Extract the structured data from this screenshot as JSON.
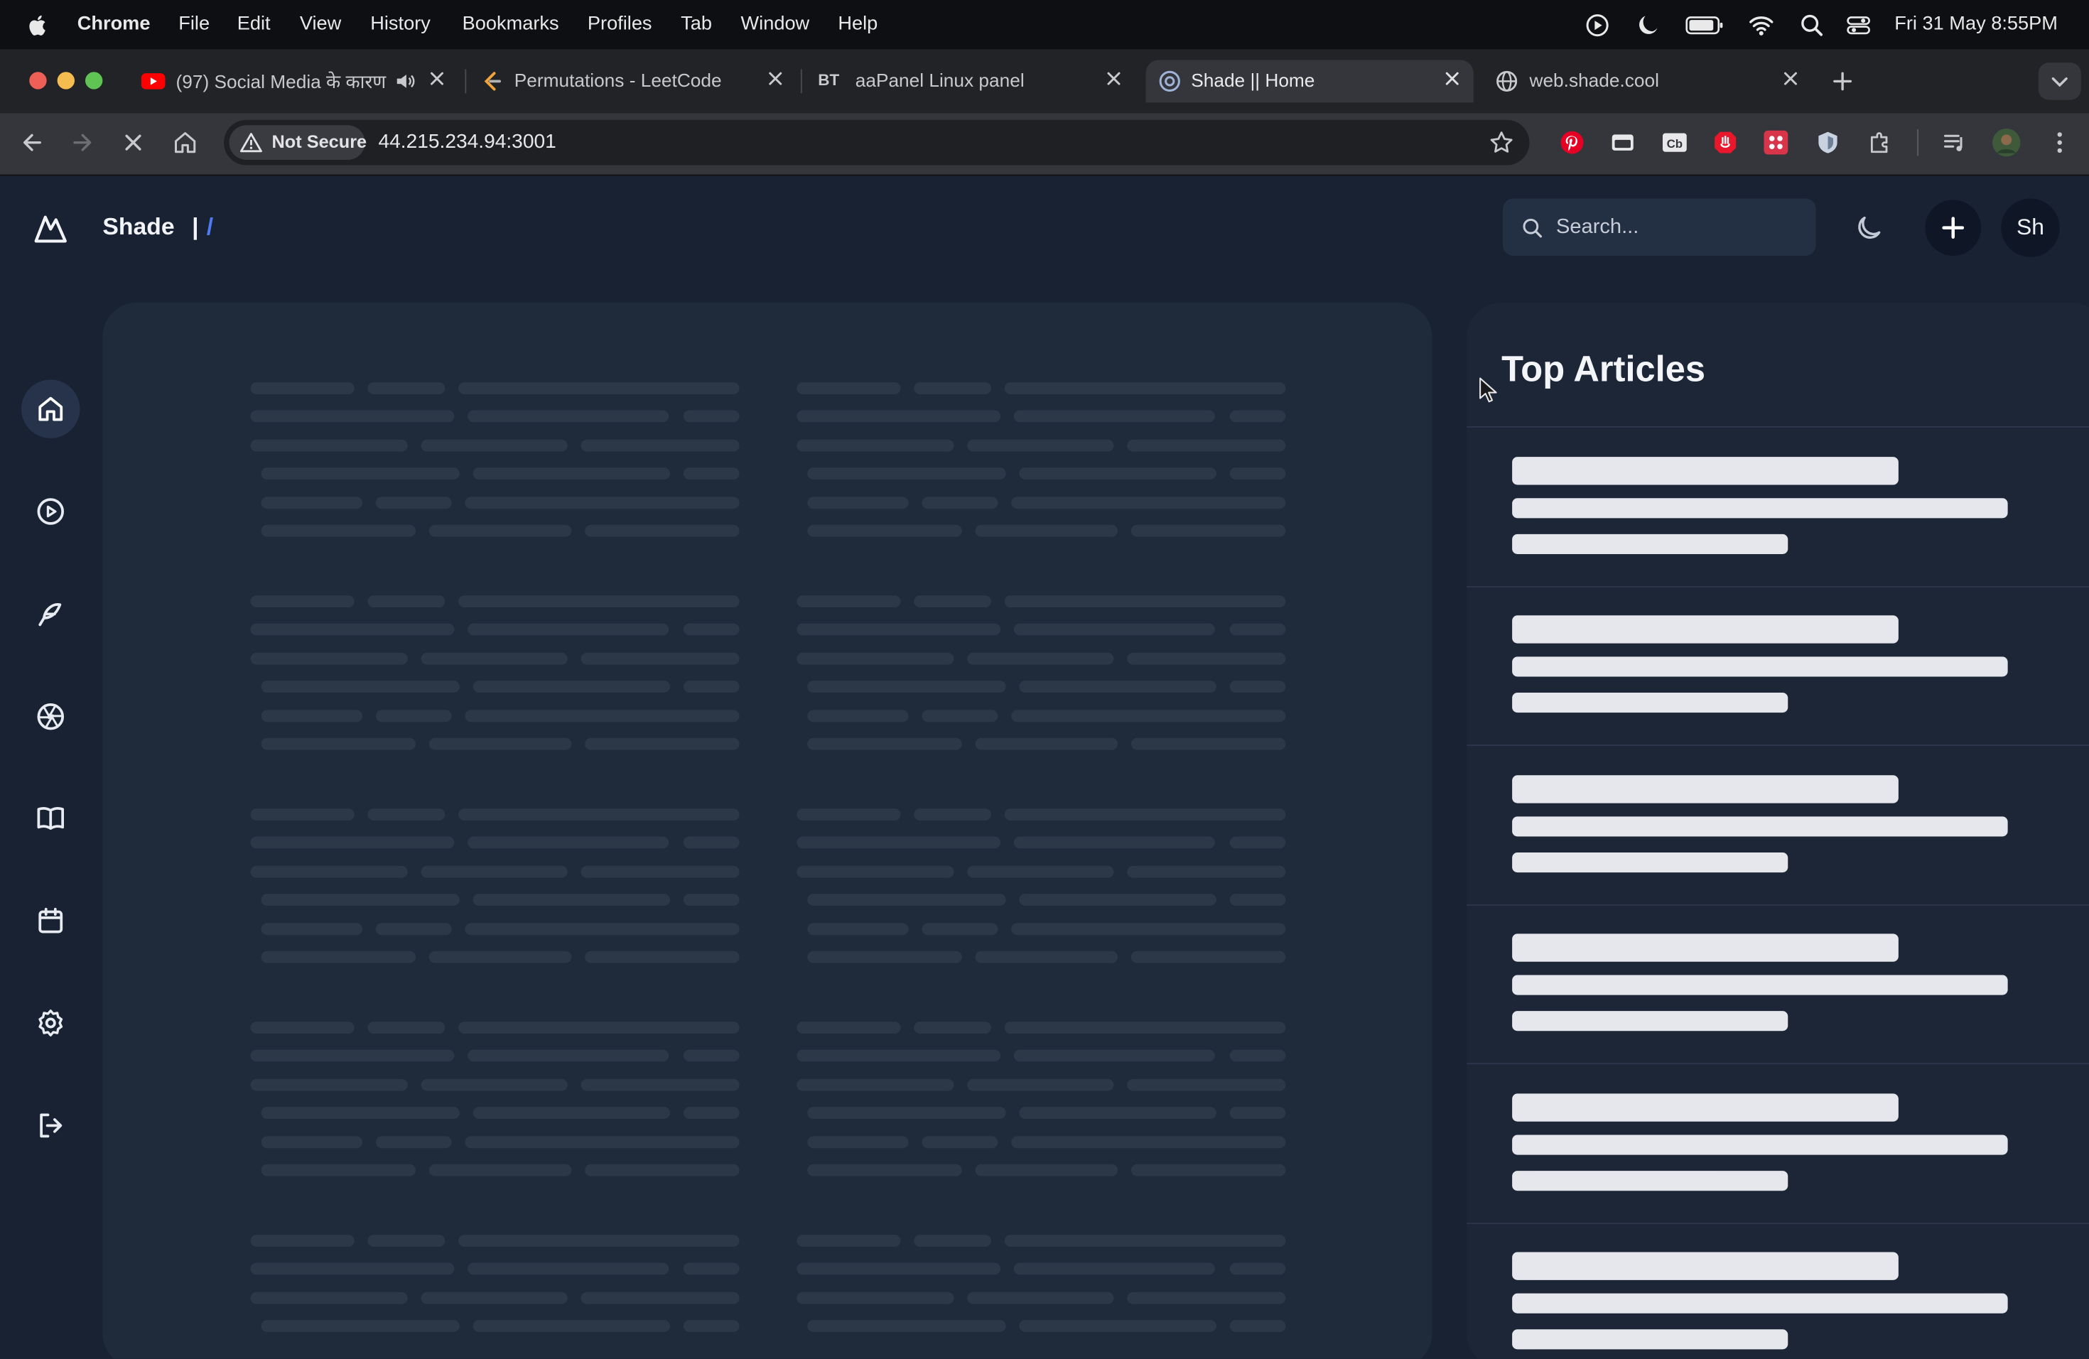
{
  "menubar": {
    "app": "Chrome",
    "items": [
      "File",
      "Edit",
      "View",
      "History",
      "Bookmarks",
      "Profiles",
      "Tab",
      "Window",
      "Help"
    ],
    "datetime": "Fri 31 May  8:55PM"
  },
  "tabs": [
    {
      "title": "(97) Social Media के कारण",
      "favicon": "youtube-icon"
    },
    {
      "title": "Permutations - LeetCode",
      "favicon": "leetcode-icon"
    },
    {
      "title": "aaPanel Linux panel",
      "favicon": "bt-icon",
      "badge": "BT"
    },
    {
      "title": "Shade || Home",
      "favicon": "shade-icon",
      "active": true
    },
    {
      "title": "web.shade.cool",
      "favicon": "globe-icon"
    }
  ],
  "omnibox": {
    "security_label": "Not Secure",
    "url": "44.215.234.94:3001"
  },
  "app": {
    "brand": "Shade",
    "breadcrumb_sep": "|",
    "breadcrumb_path": "/",
    "search_placeholder": "Search...",
    "avatar_initials": "Sh"
  },
  "sidebar": {
    "items": [
      {
        "icon": "home-icon",
        "active": true
      },
      {
        "icon": "play-icon"
      },
      {
        "icon": "feather-icon"
      },
      {
        "icon": "aperture-icon"
      },
      {
        "icon": "book-icon"
      },
      {
        "icon": "calendar-icon"
      },
      {
        "icon": "settings-icon"
      },
      {
        "icon": "logout-icon"
      }
    ]
  },
  "top_articles": {
    "title": "Top Articles"
  },
  "colors": {
    "accent": "#4f7bf2",
    "background": "#182232",
    "panel": "#1f2a3b",
    "skeleton": "#2c3748"
  }
}
